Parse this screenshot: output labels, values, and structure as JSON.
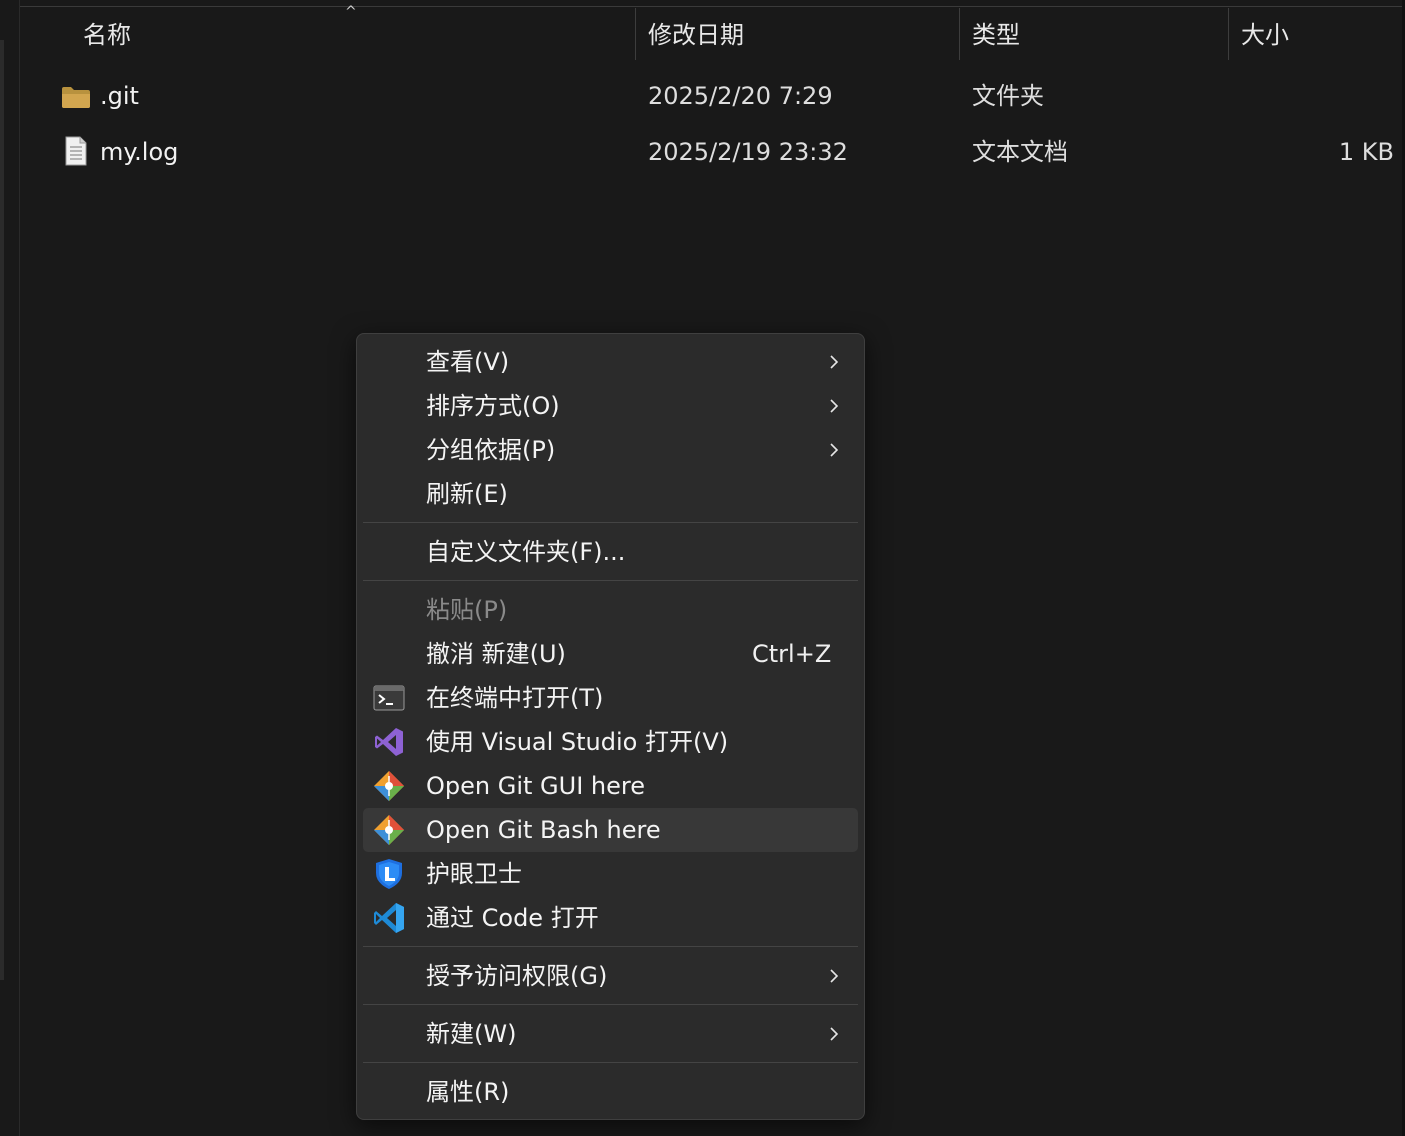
{
  "columns": {
    "name": "名称",
    "modified": "修改日期",
    "type": "类型",
    "size": "大小"
  },
  "sort_indicator": "^",
  "files": [
    {
      "icon": "folder-icon",
      "name": ".git",
      "modified": "2025/2/20 7:29",
      "type": "文件夹",
      "size": ""
    },
    {
      "icon": "text-file-icon",
      "name": "my.log",
      "modified": "2025/2/19 23:32",
      "type": "文本文档",
      "size": "1 KB"
    }
  ],
  "context_menu": {
    "items": [
      {
        "label": "查看(V)",
        "submenu": true
      },
      {
        "label": "排序方式(O)",
        "submenu": true
      },
      {
        "label": "分组依据(P)",
        "submenu": true
      },
      {
        "label": "刷新(E)"
      },
      {
        "label": "自定义文件夹(F)..."
      },
      {
        "label": "粘贴(P)",
        "disabled": true
      },
      {
        "label": "撤消 新建(U)",
        "shortcut": "Ctrl+Z"
      },
      {
        "label": "在终端中打开(T)",
        "icon": "terminal-icon"
      },
      {
        "label": "使用 Visual Studio 打开(V)",
        "icon": "visual-studio-icon"
      },
      {
        "label": "Open Git GUI here",
        "icon": "git-icon"
      },
      {
        "label": "Open Git Bash here",
        "icon": "git-icon",
        "highlighted": true
      },
      {
        "label": "护眼卫士",
        "icon": "eye-guard-shield-icon"
      },
      {
        "label": "通过 Code 打开",
        "icon": "vscode-icon"
      },
      {
        "label": "授予访问权限(G)",
        "submenu": true
      },
      {
        "label": "新建(W)",
        "submenu": true
      },
      {
        "label": "属性(R)"
      }
    ]
  },
  "colors": {
    "background": "#191919",
    "menu_background": "#2b2b2b",
    "menu_highlight": "#383838",
    "folder": "#c9a04a"
  }
}
